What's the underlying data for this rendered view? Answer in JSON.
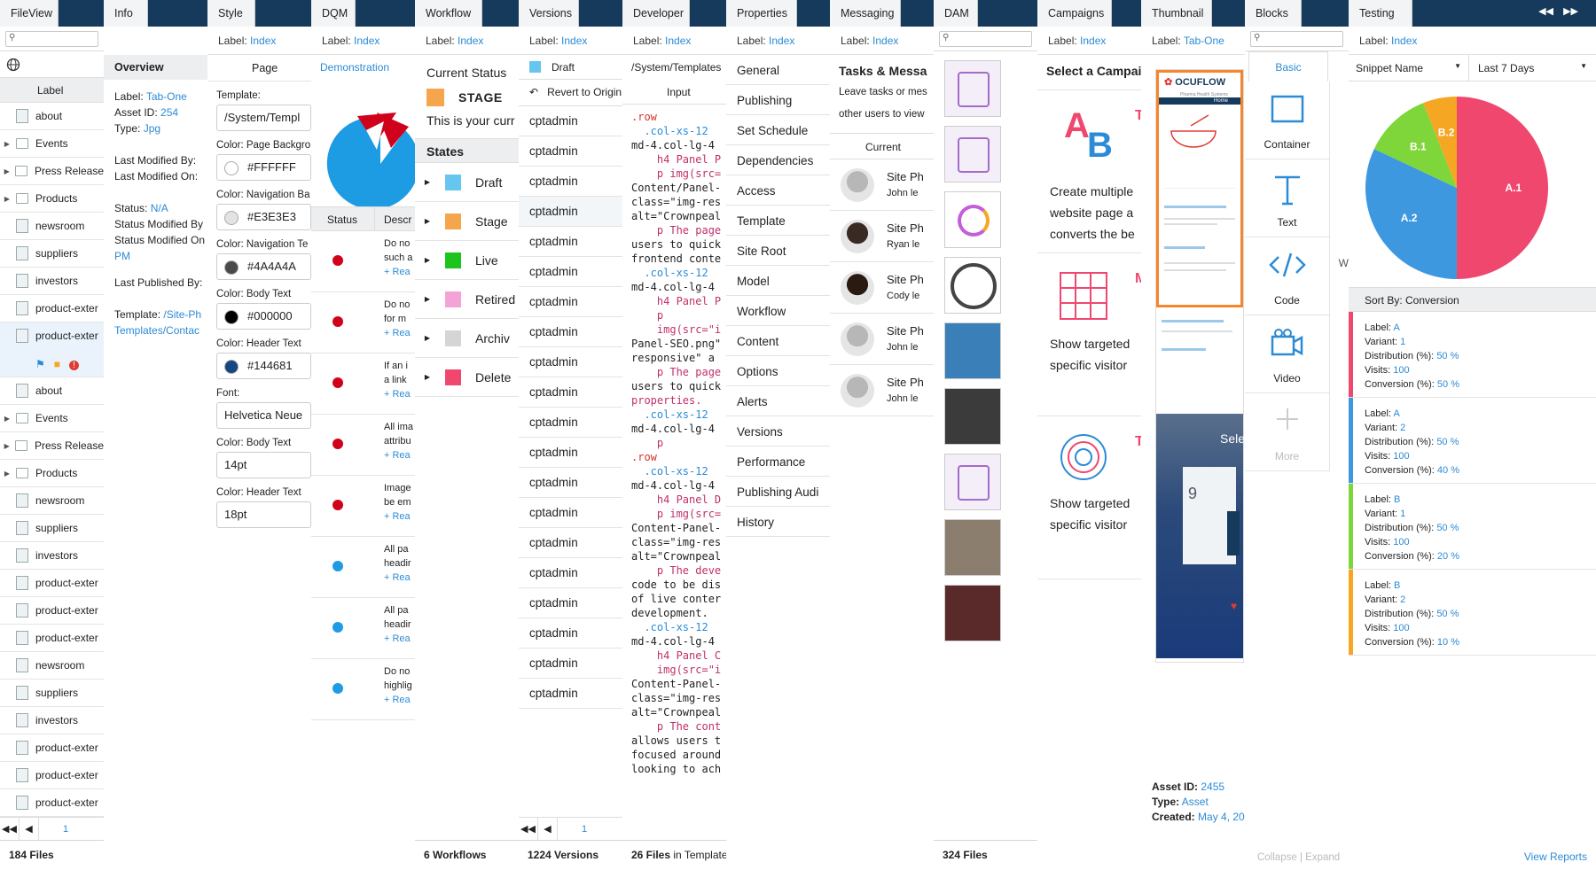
{
  "panels": {
    "fileview": {
      "tab": "FileView",
      "column": "Label",
      "items": [
        "about",
        "Events",
        "Press Release",
        "Products",
        "newsroom",
        "suppliers",
        "investors",
        "product-exter",
        "product-exter",
        "about",
        "Events",
        "Press Release",
        "Products",
        "newsroom",
        "suppliers",
        "investors",
        "product-exter",
        "product-exter",
        "product-exter",
        "newsroom",
        "suppliers",
        "investors",
        "product-exter",
        "product-exter",
        "product-exter"
      ],
      "page": "1",
      "footer": "184 Files"
    },
    "info": {
      "tab": "Info",
      "heading": "Overview",
      "label_key": "Label:",
      "label_val": "Tab-One",
      "asset_key": "Asset ID:",
      "asset_val": "254",
      "type_key": "Type:",
      "type_val": "Jpg",
      "lmb": "Last Modified By:",
      "lmo": "Last Modified On:",
      "status_key": "Status:",
      "status_val": "N/A",
      "smb": "Status Modified By",
      "smo": "Status Modified On",
      "pm": "PM",
      "lpb": "Last Published By:",
      "tpl_key": "Template:",
      "tpl_val": "/Site-Ph",
      "tpl_val2": "Templates/Contac"
    },
    "style": {
      "tab": "Style",
      "label_key": "Label:",
      "label_val": "Index",
      "page": "Page",
      "template_lbl": "Template:",
      "template_val": "/System/Templ",
      "c1_lbl": "Color: Page Backgro",
      "c1_val": "#FFFFFF",
      "c2_lbl": "Color: Navigation Ba",
      "c2_val": "#E3E3E3",
      "c3_lbl": "Color: Navigation Te",
      "c3_val": "#4A4A4A",
      "c4_lbl": "Color: Body Text",
      "c4_val": "#000000",
      "c5_lbl": "Color: Header Text",
      "c5_val": "#144681",
      "font_lbl": "Font:",
      "font_val": "Helvetica Neue",
      "bt_lbl": "Color: Body Text",
      "bt_val": "14pt",
      "ht_lbl": "Color: Header Text",
      "ht_val": "18pt"
    },
    "dqm": {
      "tab": "DQM",
      "label_key": "Label:",
      "label_val": "Index",
      "demo": "Demonstration",
      "col1": "Status",
      "col2": "Descr",
      "rows": [
        {
          "t1": "Do no",
          "t2": "such a",
          "rd": "+ Rea"
        },
        {
          "t1": "Do no",
          "t2": "for m",
          "rd": "+ Rea"
        },
        {
          "t1": "If an i",
          "t2": "a link",
          "rd": "+ Rea"
        },
        {
          "t1": "All ima",
          "t2": "attribu",
          "rd": "+ Rea"
        },
        {
          "t1": "Image",
          "t2": "be em",
          "rd": "+ Rea"
        },
        {
          "t1": "All pa",
          "t2": "headir",
          "rd": "+ Rea"
        },
        {
          "t1": "All pa",
          "t2": "headir",
          "rd": "+ Rea"
        },
        {
          "t1": "Do no",
          "t2": "highlig",
          "rd": "+ Rea"
        }
      ]
    },
    "workflow": {
      "tab": "Workflow",
      "label_key": "Label:",
      "label_val": "Index",
      "current": "Current Status",
      "stage": "STAGE",
      "desc": "This is your curr",
      "states": "States",
      "items": [
        "Draft",
        "Stage",
        "Live",
        "Retired",
        "Archiv",
        "Delete"
      ],
      "footer": "6 Workflows"
    },
    "versions": {
      "tab": "Versions",
      "label_key": "Label:",
      "label_val": "Index",
      "draft": "Draft",
      "revert": "Revert to Origin",
      "user": "cptadmin",
      "page": "1",
      "footer": "1224 Versions"
    },
    "developer": {
      "tab": "Developer",
      "label_key": "Label:",
      "label_val": "Index",
      "path": "/System/Templates",
      "input": "Input",
      "code": [
        ".row",
        "  .col-xs-12",
        "md-4.col-lg-4",
        "    h4 Panel P",
        "    p img(src=",
        "Content/Panel-",
        "class=\"img-res",
        "alt=\"Crownpeal",
        "    p The page",
        "users to quick",
        "frontend conte",
        "  .col-xs-12",
        "md-4.col-lg-4",
        "    h4 Panel P",
        "    p",
        "    img(src=\"i",
        "Panel-SEO.png\"",
        "responsive\" a",
        "    p The page",
        "users to quick",
        "properties.",
        "  .col-xs-12",
        "md-4.col-lg-4",
        "    p",
        ".row",
        "  .col-xs-12",
        "md-4.col-lg-4",
        "    h4 Panel D",
        "    p img(src=",
        "Content-Panel-",
        "class=\"img-res",
        "alt=\"Crownpeal",
        "    p The deve",
        "code to be dis",
        "of live conter",
        "development.",
        "  .col-xs-12",
        "md-4.col-lg-4",
        "    h4 Panel C",
        "    img(src=\"i",
        "Content-Panel-",
        "class=\"img-res",
        "alt=\"Crownpeal",
        "    p The cont",
        "allows users t",
        "focused around",
        "looking to ach"
      ],
      "footer_b": "26 Files",
      "footer_n": " in Template"
    },
    "properties": {
      "tab": "Properties",
      "label_key": "Label:",
      "label_val": "Index",
      "items": [
        "General",
        "Publishing",
        "Set Schedule",
        "Dependencies",
        "Access",
        "Template",
        "Site Root",
        "Model",
        "Workflow",
        "Content",
        "Options",
        "Alerts",
        "Versions",
        "Performance",
        "Publishing Audi",
        "History"
      ]
    },
    "messaging": {
      "tab": "Messaging",
      "label_key": "Label:",
      "label_val": "Index",
      "title": "Tasks & Messa",
      "sub1": "Leave tasks or mes",
      "sub2": "other users to view",
      "current": "Current",
      "msgs": [
        {
          "t": "Site Ph",
          "s": "John le"
        },
        {
          "t": "Site Ph",
          "s": "Ryan le"
        },
        {
          "t": "Site Ph",
          "s": "Cody le"
        },
        {
          "t": "Site Ph",
          "s": "John le"
        },
        {
          "t": "Site Ph",
          "s": "John le"
        }
      ]
    },
    "dam": {
      "tab": "DAM",
      "footer": "324 Files"
    },
    "campaigns": {
      "tab": "Campaigns",
      "label_key": "Label:",
      "label_val": "Index",
      "title": "Select a Campai",
      "c1a": "Create multiple",
      "c1b": "website page a",
      "c1c": "converts the be",
      "c2a": "Show targeted",
      "c2b": "specific visitor",
      "c3a": "Show targeted",
      "c3b": "specific visitor",
      "ltr": "T",
      "ltr2": "M",
      "ltr3": "T",
      "ab_a": "A",
      "ab_b": "B"
    },
    "thumbnail": {
      "tab": "Thumbnail",
      "label_key": "Label:",
      "label_val": "Tab-One",
      "brand": "OCUFLOW",
      "brand_sub": "Pharma Health Systems",
      "home": "Home",
      "asset_key": "Asset ID:",
      "asset_val": "2455",
      "type_key": "Type:",
      "type_val": "Asset",
      "created_key": "Created:",
      "created_val": "May 4, 20",
      "n9": "9",
      "sel": "Sele"
    },
    "blocks": {
      "tab": "Blocks",
      "basic": "Basic",
      "items": [
        "Container",
        "Text",
        "Code",
        "Video",
        "More"
      ],
      "collapse": "Collapse",
      "sep": "|",
      "expand": "Expand",
      "w": "W"
    },
    "testing": {
      "tab": "Testing",
      "label_key": "Label:",
      "label_val": "Index",
      "select1": "Snippet Name",
      "select2": "Last 7 Days",
      "sort": "Sort By: Conversion",
      "view": "View Reports",
      "pie": [
        {
          "label": "A.1",
          "value": 50,
          "color": "#f0476f"
        },
        {
          "label": "A.2",
          "value": 32,
          "color": "#3d98e0"
        },
        {
          "label": "B.1",
          "value": 12,
          "color": "#7fd63a"
        },
        {
          "label": "B.2",
          "value": 6,
          "color": "#f5a623"
        }
      ],
      "blocks": [
        {
          "label": "A",
          "variant": "1",
          "dist": "50 %",
          "visits": "100",
          "conv": "50 %",
          "color": "#f0476f"
        },
        {
          "label": "A",
          "variant": "2",
          "dist": "50 %",
          "visits": "100",
          "conv": "40 %",
          "color": "#3d98e0"
        },
        {
          "label": "B",
          "variant": "1",
          "dist": "50 %",
          "visits": "100",
          "conv": "20 %",
          "color": "#7fd63a"
        },
        {
          "label": "B",
          "variant": "2",
          "dist": "50 %",
          "visits": "100",
          "conv": "10 %",
          "color": "#f5a623"
        }
      ],
      "k_label": "Label:",
      "k_variant": "Variant:",
      "k_dist": "Distribution (%):",
      "k_visits": "Visits:",
      "k_conv": "Conversion (%):"
    }
  }
}
